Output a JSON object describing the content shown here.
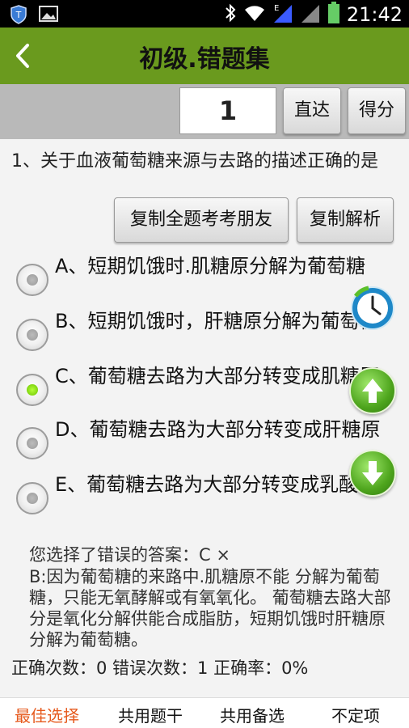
{
  "status_bar": {
    "time": "21:42",
    "icons": [
      "shield-icon",
      "image-icon",
      "bluetooth-icon",
      "wifi-icon",
      "signal-e-icon",
      "signal-icon",
      "battery-icon"
    ]
  },
  "header": {
    "title": "初级.错题集",
    "back_icon": "chevron-left-icon"
  },
  "toolbar": {
    "page_value": "1",
    "go_label": "直达",
    "score_label": "得分"
  },
  "question": {
    "text": "1、关于血液葡萄糖来源与去路的描述正确的是",
    "copy_all_label": "复制全题考考朋友",
    "copy_explain_label": "复制解析",
    "options": [
      {
        "text": "A、短期饥饿时.肌糖原分解为葡萄糖",
        "checked": false
      },
      {
        "text": "B、短期饥饿时，肝糖原分解为葡萄糖",
        "checked": false
      },
      {
        "text": "C、葡萄糖去路为大部分转变成肌糖原",
        "checked": true
      },
      {
        "text": "D、葡萄糖去路为大部分转变成肝糖原",
        "checked": false
      },
      {
        "text": "E、葡萄糖去路为大部分转变成乳酸",
        "checked": false
      }
    ]
  },
  "floating": [
    "clock-icon",
    "arrow-up-icon",
    "arrow-down-icon"
  ],
  "answer": {
    "selected_line": "您选择了错误的答案：C ×",
    "explanation": "B:因为葡萄糖的来路中.肌糖原不能 分解为葡萄糖，只能无氧酵解或有氧氧化。 葡萄糖去路大部分是氧化分解供能合成脂肪，短期饥饿时肝糖原分解为葡萄糖。",
    "stats": "正确次数：0  错误次数：1  正确率：0%"
  },
  "tabs": [
    {
      "label": "最佳选择",
      "active": true
    },
    {
      "label": "共用题干",
      "active": false
    },
    {
      "label": "共用备选",
      "active": false
    },
    {
      "label": "不定项",
      "active": false
    }
  ],
  "colors": {
    "header_bg": "#6a9a1e",
    "toolbar_bg": "#b9b9b9",
    "active_tab": "#e65a1e",
    "checked_radio": "#6ac400"
  }
}
